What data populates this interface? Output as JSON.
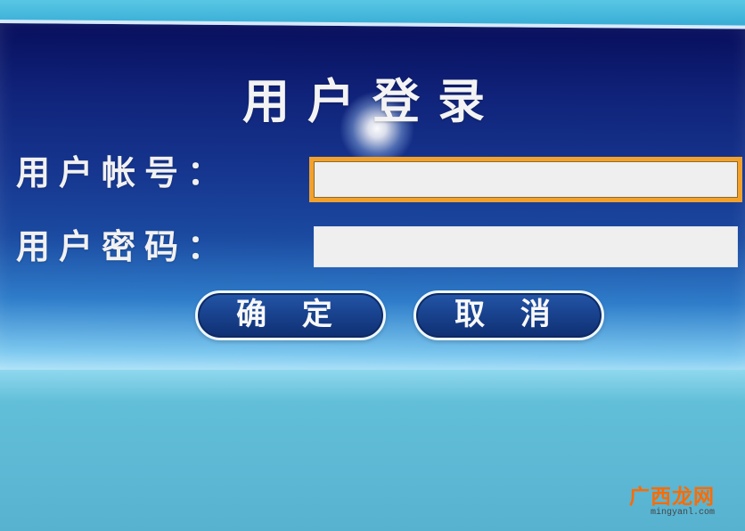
{
  "dialog": {
    "title": "用户登录",
    "account_label": "用户帐号：",
    "password_label": "用户密码：",
    "account_value": "",
    "password_value": "",
    "confirm_button": "确 定",
    "cancel_button": "取 消"
  },
  "watermark": {
    "text": "广西龙网",
    "subtext": "mingyanl.com"
  },
  "colors": {
    "focus_border": "#f2a12d",
    "panel_top": "#080f5d",
    "panel_bottom": "#b8e9fb",
    "watermark": "#ff6b00"
  }
}
